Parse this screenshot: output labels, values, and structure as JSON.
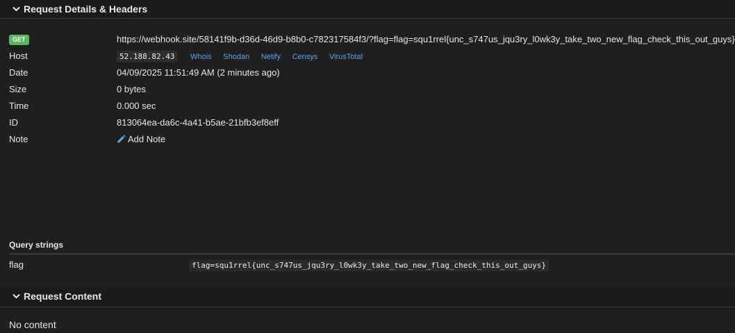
{
  "details": {
    "title": "Request Details & Headers",
    "method": "GET",
    "url": "https://webhook.site/58141f9b-d36d-46d9-b8b0-c782317584f3/?flag=flag=squ1rrel{unc_s747us_jqu3ry_l0wk3y_take_two_new_flag_check_this_out_guys}",
    "host_label": "Host",
    "host_ip": "52.188.82.43",
    "host_tools": [
      "Whois",
      "Shodan",
      "Netify",
      "Censys",
      "VirusTotal"
    ],
    "date_label": "Date",
    "date_value": "04/09/2025 11:51:49 AM (2 minutes ago)",
    "size_label": "Size",
    "size_value": "0 bytes",
    "time_label": "Time",
    "time_value": "0.000 sec",
    "id_label": "ID",
    "id_value": "813064ea-da6c-4a41-b5ae-21bfb3ef8eff",
    "note_label": "Note",
    "add_note": "Add Note"
  },
  "query_strings": {
    "title": "Query strings",
    "rows": [
      {
        "key": "flag",
        "value": "flag=squ1rrel{unc_s747us_jqu3ry_l0wk3y_take_two_new_flag_check_this_out_guys}"
      }
    ]
  },
  "content": {
    "title": "Request Content",
    "body": "No content"
  },
  "colors": {
    "background": "#1f1f1f",
    "link": "#5aa3ef",
    "get_badge": "#5cb85c"
  },
  "icons": {
    "chevron": "chevron-down-icon",
    "pencil": "pencil-icon"
  }
}
